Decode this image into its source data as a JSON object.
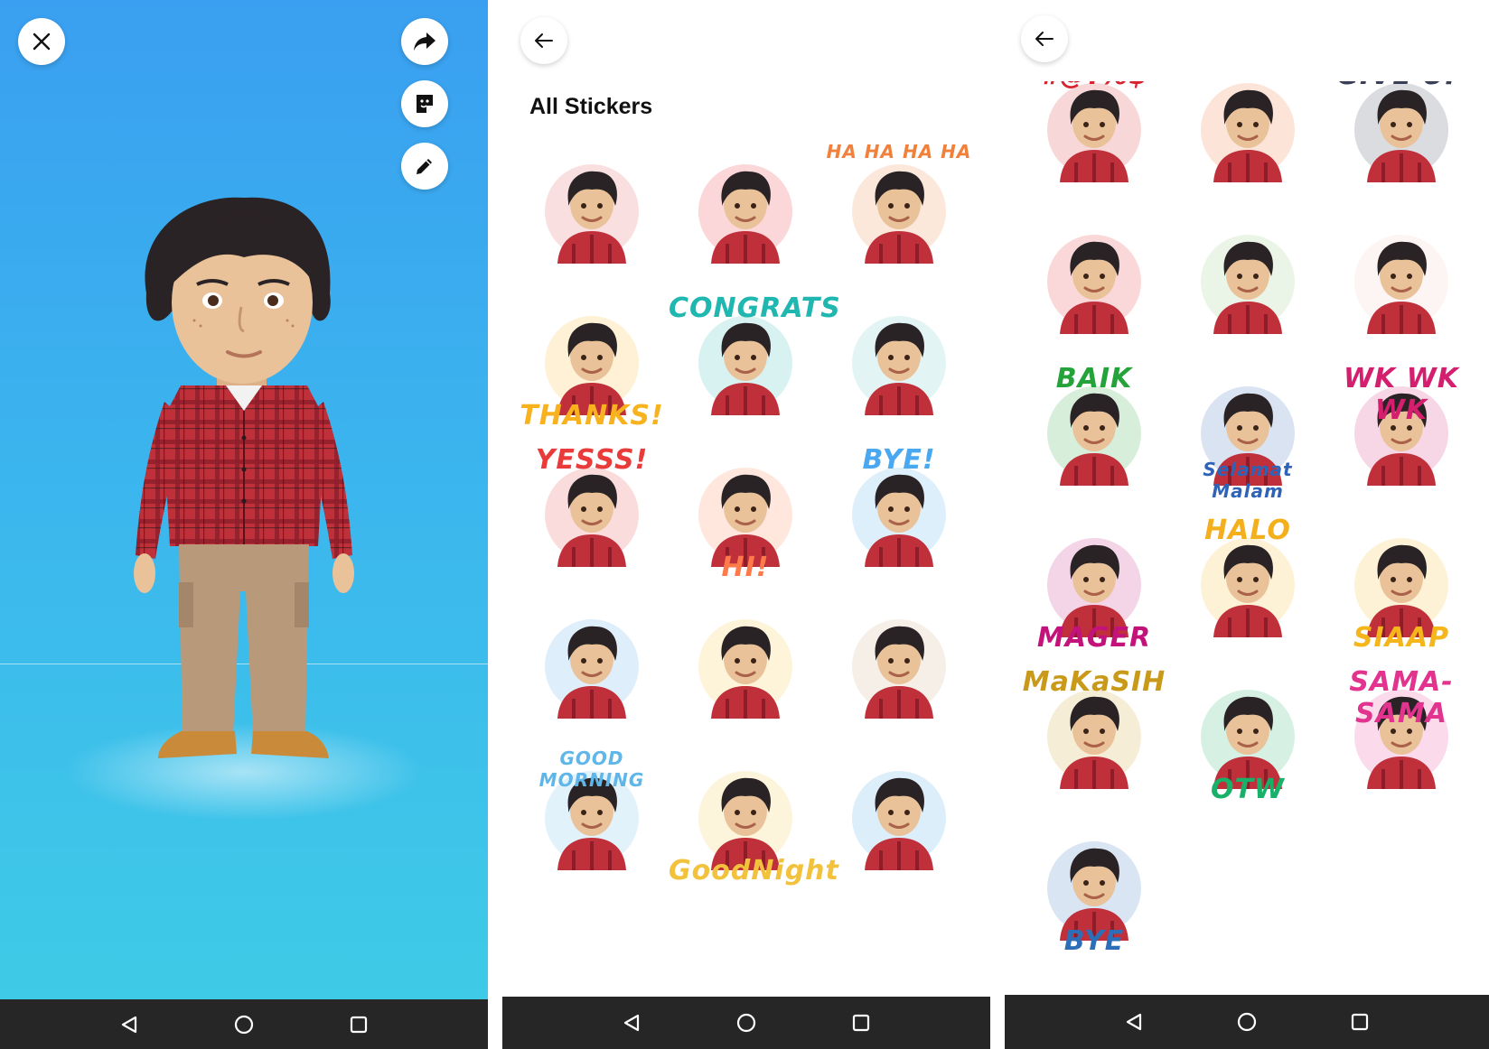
{
  "colors": {
    "shirt": "#c0303a",
    "shirt_dark": "#8e1d2a",
    "skin": "#e9c29a",
    "hair": "#2a2325",
    "pants": "#b89a7b",
    "navbar": "#262626"
  },
  "screen1": {
    "buttons": {
      "close_icon": "close-icon",
      "share_icon": "share-icon",
      "sticker_icon": "sticker-icon",
      "edit_icon": "pencil-icon"
    }
  },
  "screen2": {
    "title": "All Stickers",
    "stickers": [
      {
        "caption": "",
        "color": "#e05050"
      },
      {
        "caption": "",
        "color": "#e8222f"
      },
      {
        "caption": "HA HA HA HA",
        "color": "#f0803a"
      },
      {
        "caption": "THANKS!",
        "color": "#f7b21e"
      },
      {
        "caption": "CONGRATS",
        "color": "#1fb7b0"
      },
      {
        "caption": "",
        "color": "#5ec9c1"
      },
      {
        "caption": "YESSS!",
        "color": "#ea3b3b"
      },
      {
        "caption": "HI!",
        "color": "#ff7a4a"
      },
      {
        "caption": "BYE!",
        "color": "#4aa8f0"
      },
      {
        "caption": "",
        "color": "#4a9fe6"
      },
      {
        "caption": "",
        "color": "#f6c331"
      },
      {
        "caption": "",
        "color": "#cfa77f"
      },
      {
        "caption": "GOOD MORNING",
        "color": "#5fb6e8"
      },
      {
        "caption": "GoodNight",
        "color": "#f3c23c"
      },
      {
        "caption": "",
        "color": "#3ba0e6"
      }
    ]
  },
  "screen3": {
    "stickers": [
      {
        "caption": "#@!%$",
        "color": "#d8232e"
      },
      {
        "caption": "",
        "color": "#f36b2f"
      },
      {
        "caption": "GIVE UP",
        "color": "#3a3f55"
      },
      {
        "caption": "",
        "color": "#e3262e"
      },
      {
        "caption": "",
        "color": "#8ec97a"
      },
      {
        "caption": "",
        "color": "#f0c9c0"
      },
      {
        "caption": "BAIK",
        "color": "#24a33a"
      },
      {
        "caption": "Selamat Malam",
        "color": "#2e63b8"
      },
      {
        "caption": "WK WK WK",
        "color": "#d41f6e"
      },
      {
        "caption": "MAGER",
        "color": "#c3137a"
      },
      {
        "caption": "HALO",
        "color": "#f4b01c"
      },
      {
        "caption": "SIAAP",
        "color": "#f5b61b"
      },
      {
        "caption": "MaKaSIH",
        "color": "#c99a1a"
      },
      {
        "caption": "OTW",
        "color": "#19b06a"
      },
      {
        "caption": "SAMA-SAMA",
        "color": "#e2338e"
      },
      {
        "caption": "BYE",
        "color": "#2c6fb8"
      }
    ]
  }
}
